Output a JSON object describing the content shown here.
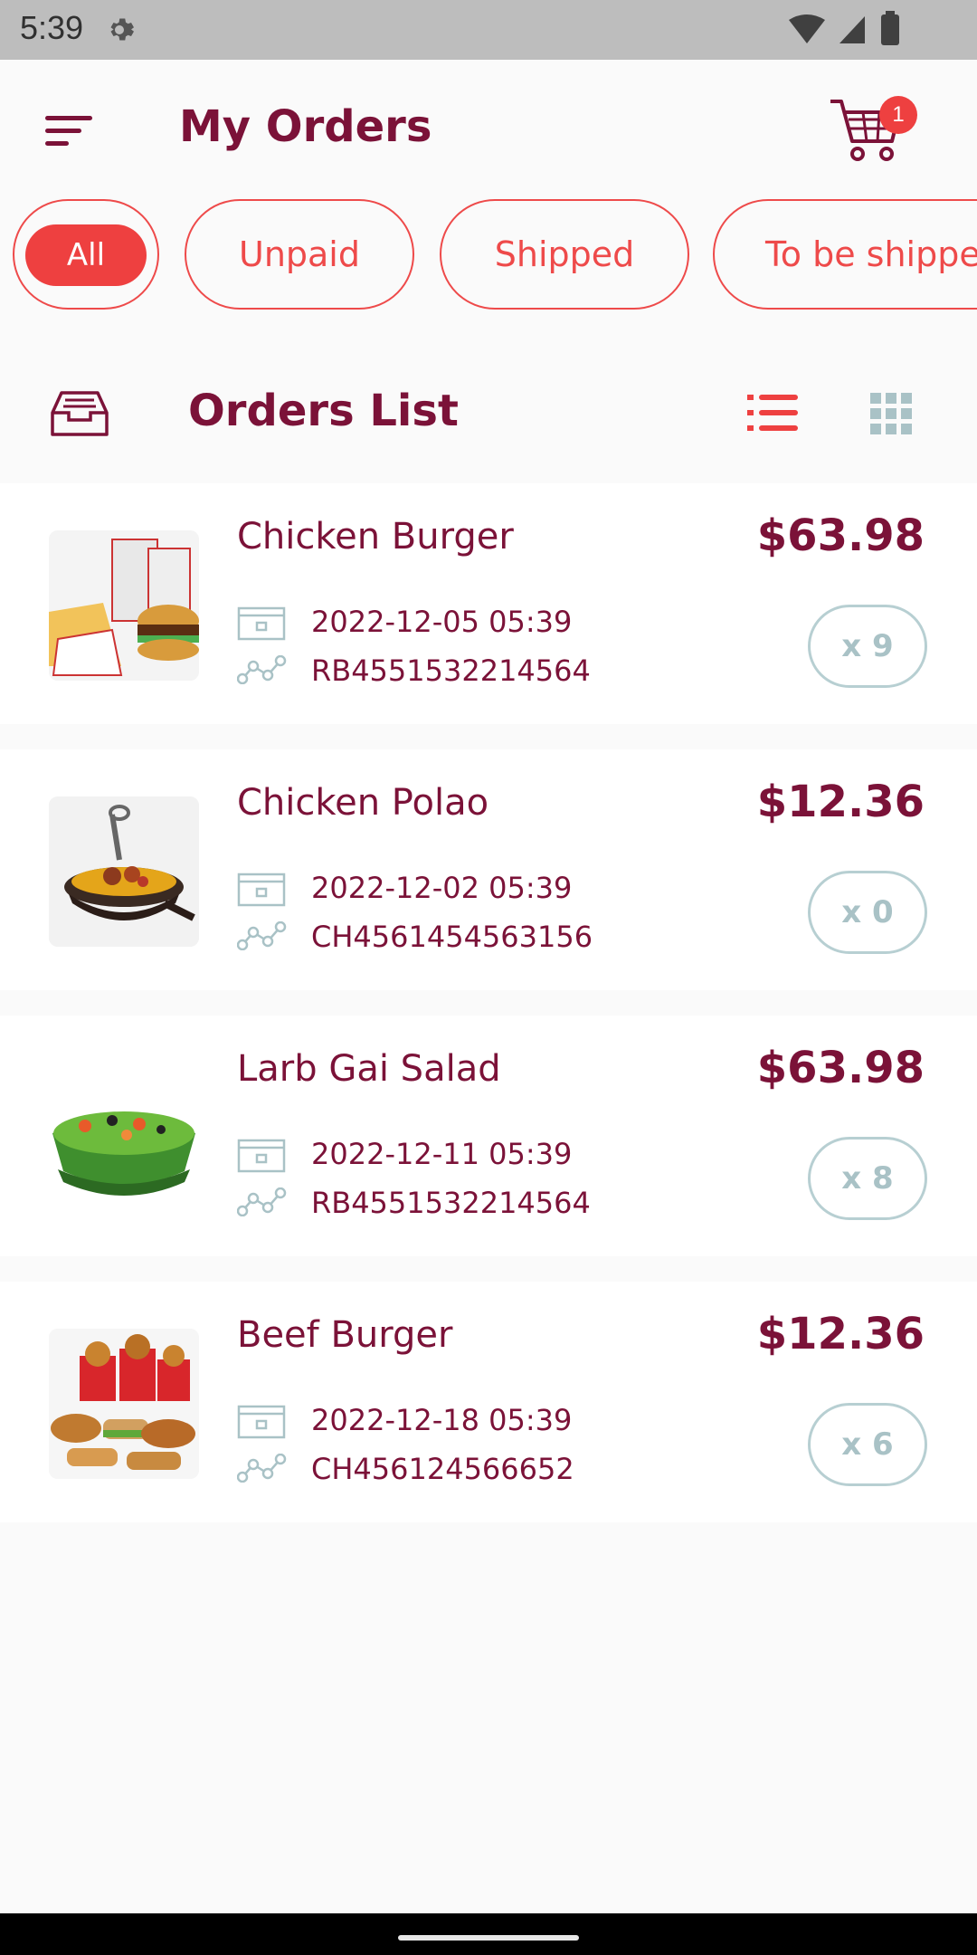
{
  "status_bar": {
    "time": "5:39"
  },
  "header": {
    "title": "My Orders",
    "cart_count": "1"
  },
  "tabs": [
    {
      "label": "All"
    },
    {
      "label": "Unpaid"
    },
    {
      "label": "Shipped"
    },
    {
      "label": "To be shipped"
    }
  ],
  "list": {
    "title": "Orders List"
  },
  "orders": [
    {
      "name": "Chicken Burger",
      "price": "$63.98",
      "date": "2022-12-05 05:39",
      "code": "RB4551532214564",
      "qty": "x 9"
    },
    {
      "name": "Chicken Polao",
      "price": "$12.36",
      "date": "2022-12-02 05:39",
      "code": "CH4561454563156",
      "qty": "x 0"
    },
    {
      "name": "Larb Gai Salad",
      "price": "$63.98",
      "date": "2022-12-11 05:39",
      "code": "RB4551532214564",
      "qty": "x 8"
    },
    {
      "name": "Beef Burger",
      "price": "$12.36",
      "date": "2022-12-18 05:39",
      "code": "CH456124566652",
      "qty": "x 6"
    }
  ],
  "colors": {
    "accent": "#ee4040",
    "text": "#7b1238",
    "muted": "#a9c2c6"
  }
}
